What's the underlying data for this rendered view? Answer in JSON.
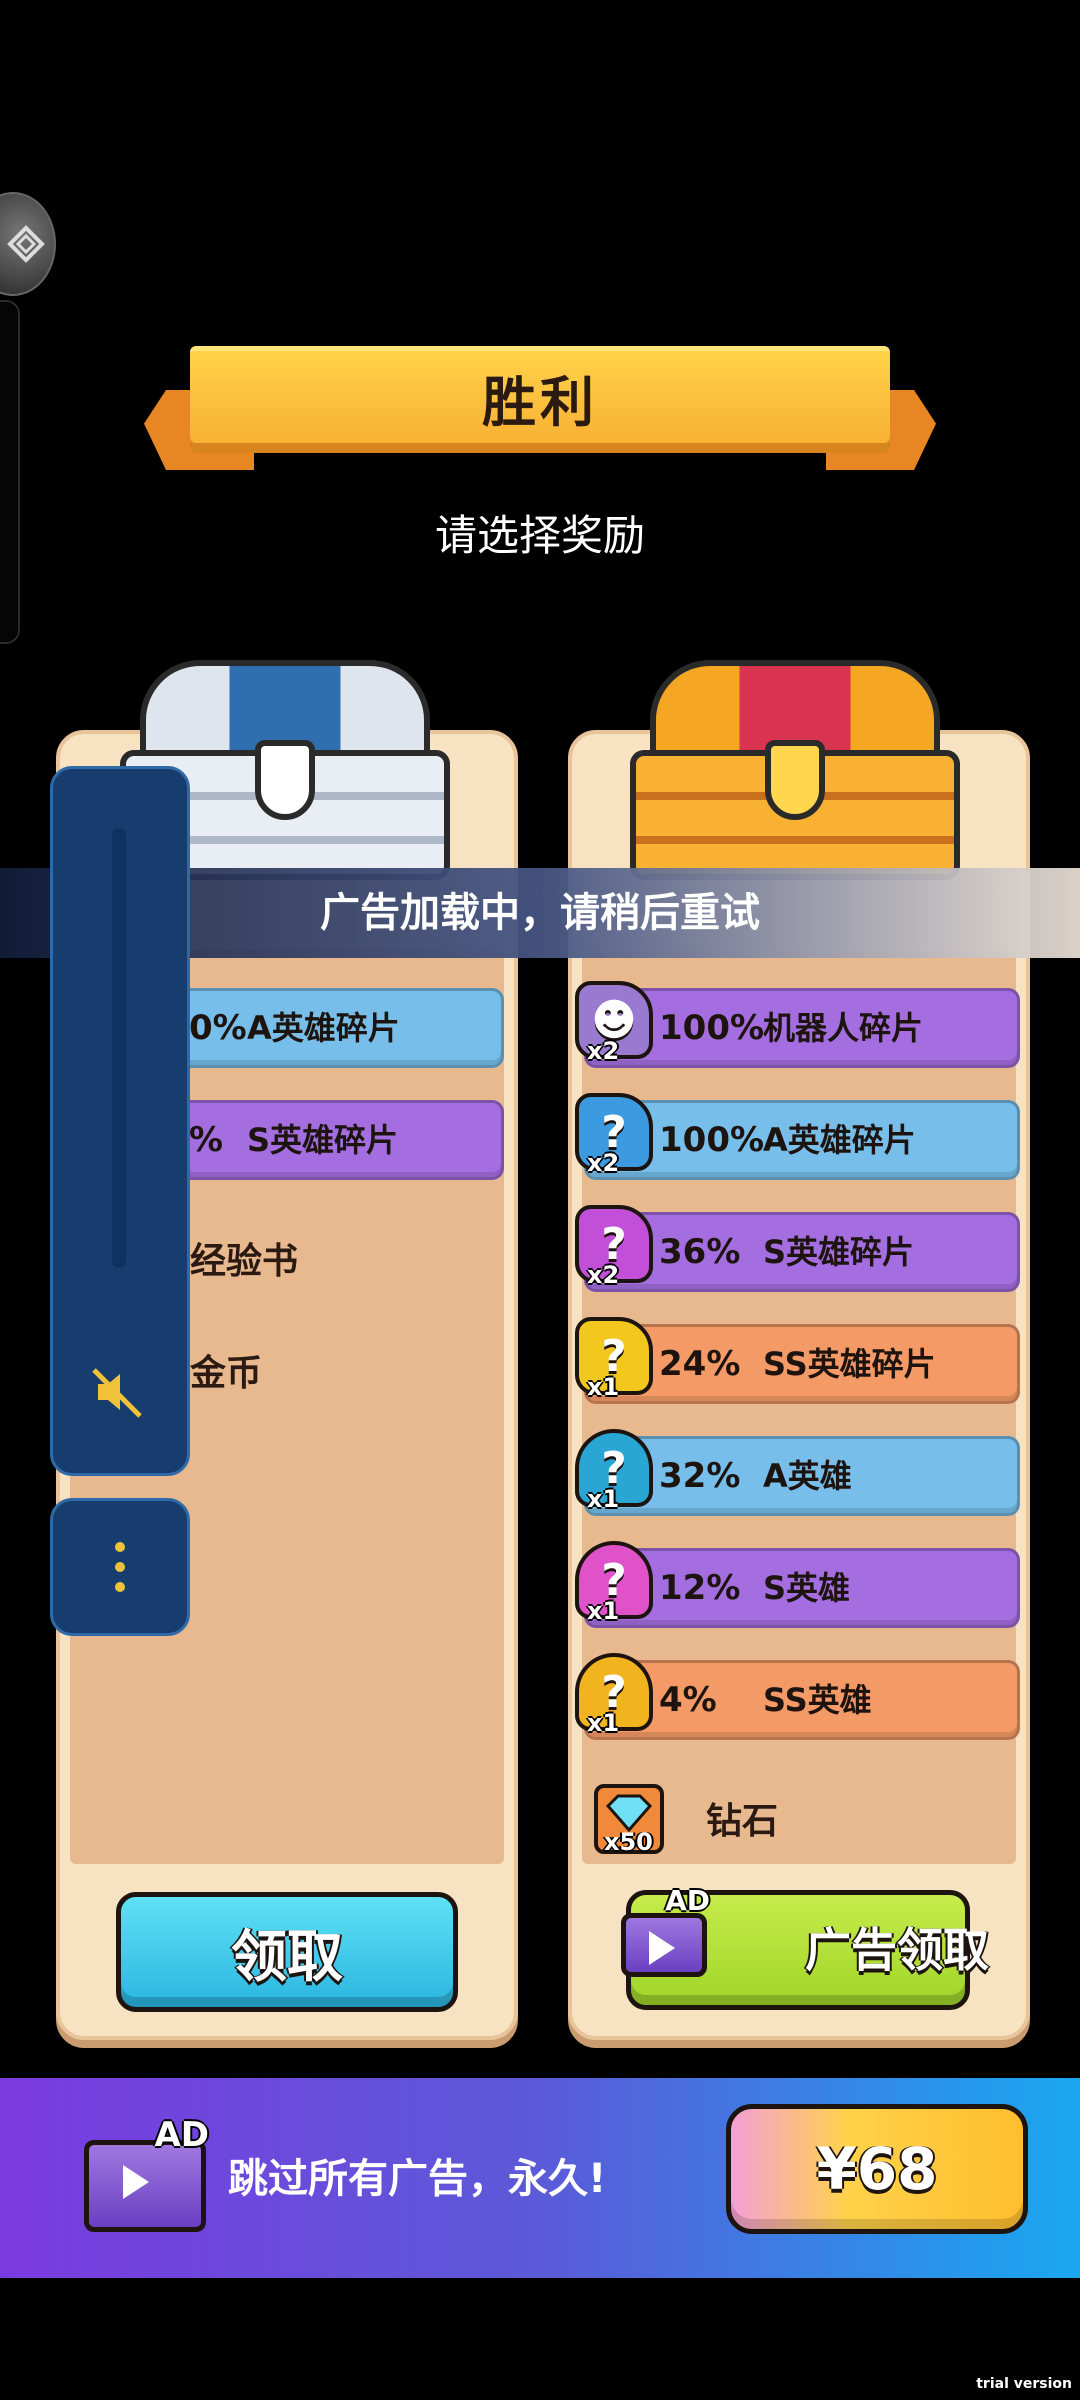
{
  "banner": {
    "title": "胜利"
  },
  "subtitle": "请选择奖励",
  "toast": "广告加载中，请稍后重试",
  "left_panel": {
    "rows": [
      {
        "pct": "0%",
        "name": "A英雄碎片",
        "color": "#77bfea"
      },
      {
        "pct": "%",
        "name": "S英雄碎片",
        "color": "#a46ee0"
      }
    ],
    "plain_items": [
      "经验书",
      "金币"
    ],
    "claim_button": "领取"
  },
  "right_panel": {
    "rows": [
      {
        "qty": "x2",
        "pct": "100%",
        "name": "机器人碎片",
        "color": "#a46ee0",
        "icon": "robot-shard-icon"
      },
      {
        "qty": "x2",
        "pct": "100%",
        "name": "A英雄碎片",
        "color": "#77bfea",
        "icon": "mystery-shard-icon"
      },
      {
        "qty": "x2",
        "pct": "36%",
        "name": "S英雄碎片",
        "color": "#a46ee0",
        "icon": "mystery-shard-icon"
      },
      {
        "qty": "x1",
        "pct": "24%",
        "name": "SS英雄碎片",
        "color": "#f49a66",
        "icon": "mystery-shard-icon"
      },
      {
        "qty": "x1",
        "pct": "32%",
        "name": "A英雄",
        "color": "#77bfea",
        "icon": "mystery-hero-icon"
      },
      {
        "qty": "x1",
        "pct": "12%",
        "name": "S英雄",
        "color": "#a46ee0",
        "icon": "mystery-hero-icon"
      },
      {
        "qty": "x1",
        "pct": "4%",
        "name": "SS英雄",
        "color": "#f49a66",
        "icon": "mystery-hero-icon"
      }
    ],
    "diamond": {
      "qty": "x50",
      "name": "钻石"
    },
    "ad_claim_button": "广告领取",
    "ad_badge": "AD"
  },
  "promo": {
    "ad_badge": "AD",
    "text": "跳过所有广告，永久!",
    "price": "¥68"
  },
  "watermark": "trial version"
}
